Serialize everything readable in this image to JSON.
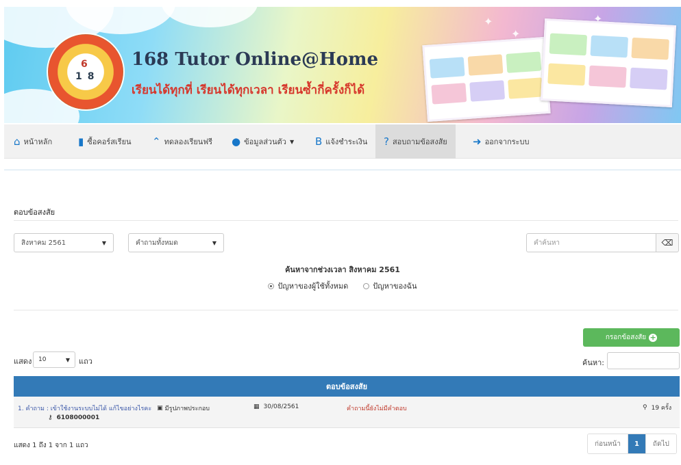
{
  "brand": {
    "title": "168 Tutor Online@Home",
    "subtitle": "เรียนได้ทุกที่ เรียนได้ทุกเวลา เรียนซ้ำกี่ครั้งก็ได้",
    "logo_text": "Tutor Online@Home"
  },
  "nav": [
    {
      "label": "หน้าหลัก",
      "icon": "home-icon"
    },
    {
      "label": "ซื้อคอร์สเรียน",
      "icon": "book-icon"
    },
    {
      "label": "ทดลองเรียนฟรี",
      "icon": "graduation-cap-icon"
    },
    {
      "label": "ข้อมูลส่วนตัว",
      "icon": "user-icon"
    },
    {
      "label": "แจ้งชำระเงิน",
      "icon": "bitcoin-icon"
    },
    {
      "label": "สอบถามข้อสงสัย",
      "icon": "question-circle-icon"
    },
    {
      "label": "ออกจากระบบ",
      "icon": "sign-out-icon"
    }
  ],
  "panel": {
    "title": "ตอบข้อสงสัย",
    "month_select": "สิงหาคม 2561",
    "question_filter": "คำถามทั้งหมด",
    "search_placeholder": "คำค้นหา",
    "range_text": "ค้นหาจากช่วงเวลา สิงหาคม 2561",
    "radio_all": "ปัญหาของผู้ใช้ทั้งหมด",
    "radio_mine": "ปัญหาของฉัน",
    "add_button": "กรอกข้อสงสัย"
  },
  "table": {
    "show_label": "แสดง",
    "page_length": "10",
    "rows_label": "แถว",
    "filter_label": "ค้นหา:",
    "header": "ตอบข้อสงสัย",
    "rows": [
      {
        "question": "1. คำถาม : เข้าใช้งานระบบไม่ได้ แก้ไขอย่างไรคะ",
        "attachment": "มีรูปภาพประกอบ",
        "user_id": "6108000001",
        "date": "30/08/2561",
        "status": "คำถามนี้ยังไม่มีคำตอบ",
        "views": "19 ครั้ง"
      }
    ],
    "info": "แสดง 1 ถึง 1 จาก 1 แถว",
    "pager": {
      "prev": "ก่อนหน้า",
      "current": "1",
      "next": "ถัดไป"
    }
  }
}
